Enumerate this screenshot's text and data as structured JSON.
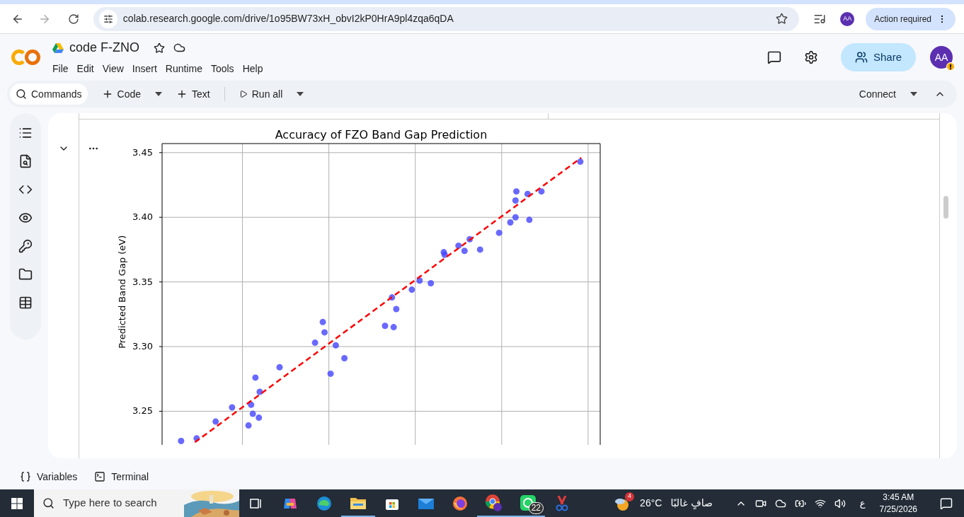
{
  "browser": {
    "url": "colab.research.google.com/drive/1o95BW73xH_obvI2kP0HrA9pl4zqa6qDA",
    "avatar": "AA",
    "action_button": "Action required"
  },
  "notebook": {
    "title": "code F-ZNO",
    "menu": [
      "File",
      "Edit",
      "View",
      "Insert",
      "Runtime",
      "Tools",
      "Help"
    ],
    "toolbar": [
      {
        "kind": "search",
        "label": "Commands"
      },
      {
        "kind": "add",
        "label": "Code",
        "caret": true
      },
      {
        "kind": "add",
        "label": "Text",
        "caret": false
      },
      {
        "kind": "run",
        "label": "Run all",
        "caret": true
      }
    ],
    "connect": "Connect",
    "share": "Share",
    "avatar": "AA"
  },
  "output": {
    "plot": {
      "title": "Accuracy of FZO Band Gap Prediction",
      "ylabel": "Predicted Band Gap (eV)",
      "yticks": [
        "3.45",
        "3.40",
        "3.35",
        "3.30",
        "3.25"
      ]
    }
  },
  "bottom_bar": [
    "Variables",
    "Terminal"
  ],
  "taskbar": {
    "search_placeholder": "Type here to search",
    "whatsapp_badge": "22",
    "weather_badge": "4",
    "temperature": "26°C",
    "weather": "صافٍ غالبًا",
    "language": "ع",
    "time": "3:45 AM",
    "date": "7/25/2026"
  }
}
